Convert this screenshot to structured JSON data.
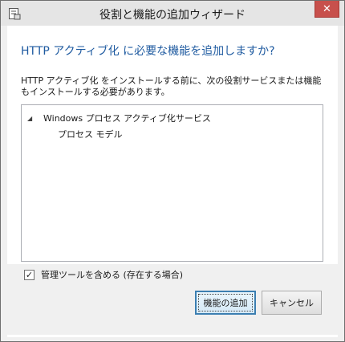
{
  "window": {
    "title": "役割と機能の追加ウィザード",
    "close_glyph": "✕"
  },
  "dialog": {
    "heading": "HTTP アクティブ化 に必要な機能を追加しますか?",
    "description": "HTTP アクティブ化 をインストールする前に、次の役割サービスまたは機能もインストールする必要があります。"
  },
  "tree": {
    "items": [
      {
        "label": "Windows プロセス アクティブ化サービス",
        "expanded": true,
        "expand_glyph": "◢"
      },
      {
        "label": "プロセス モデル"
      }
    ]
  },
  "options": {
    "include_tools_label": "管理ツールを含める (存在する場合)",
    "include_tools_checked": true,
    "check_glyph": "✓"
  },
  "buttons": {
    "add_features": "機能の追加",
    "cancel": "キャンセル"
  },
  "colors": {
    "heading": "#1e5aa0",
    "close_button": "#c7504c",
    "primary_border": "#3c7fb1"
  }
}
